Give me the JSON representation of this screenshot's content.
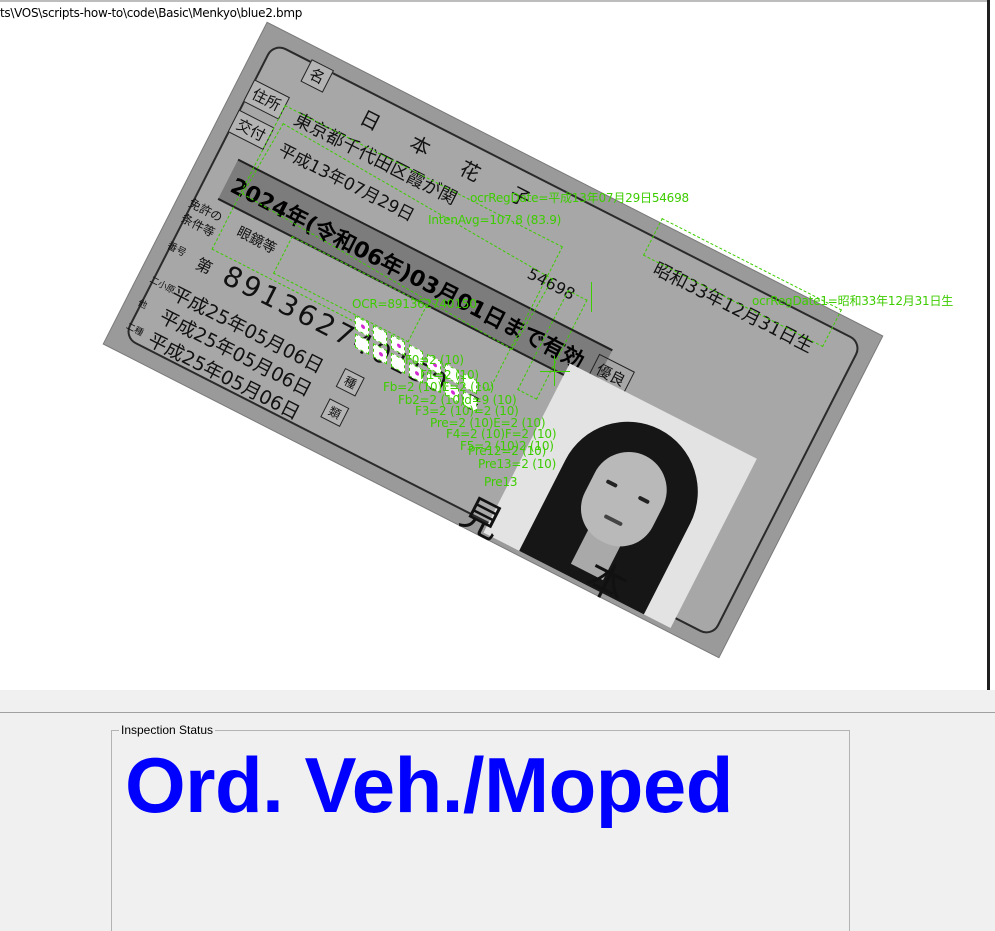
{
  "viewer": {
    "file_path": "ts\\VOS\\scripts-how-to\\code\\Basic\\Menkyo\\blue2.bmp"
  },
  "card": {
    "name_label": "名",
    "name_value": "日　本　花　子",
    "birth_value": "昭和33年12月31日生",
    "address_label": "住所",
    "address_value": "東京都千代田区霞が関",
    "issue_label": "交付",
    "issue_value": "平成13年07月29日",
    "issue_number": "54698",
    "expiry_value": "2024年(令和06年)03月01日まで有効",
    "conditions_label": "免許の条件等",
    "conditions_value": "眼鏡等",
    "number_label": "番号",
    "number_prefix": "第",
    "number_value": "891362740150",
    "number_suffix": "号",
    "dates": [
      "平成25年05月06日",
      "平成25年05月06日",
      "平成25年05月06日"
    ],
    "date_labels": [
      "二小原",
      "他",
      "二種"
    ],
    "type_labels": [
      "種",
      "類"
    ],
    "sample_mark": "見　本",
    "status_color_label": "優良"
  },
  "overlays": {
    "ocr_reg_date": "ocrRegDate=平成13年07月29日54698",
    "inten_avg": "IntenAvg=107.8 (83.9)",
    "ocr_reg_date1": "ocrRegDate1=昭和33年12月31日生",
    "ocr_number": "OCR=891362740150",
    "fields": [
      "F0=2 (10)",
      "F1=2 (10)",
      "Fb=2 (10)E=2 (10)",
      "Fb2=2 (10)d=9 (10)",
      "F3=2 (10)=2 (10)",
      "Pre=2 (10)E=2 (10)",
      "F4=2 (10)F=2 (10)",
      "F5=2 (10)2 (10)",
      "Pre12=2 (10)",
      "Pre13=2 (10)",
      "Pre13"
    ]
  },
  "status": {
    "legend": "Inspection Status",
    "value": "Ord. Veh./Moped",
    "color": "#0000ff"
  }
}
